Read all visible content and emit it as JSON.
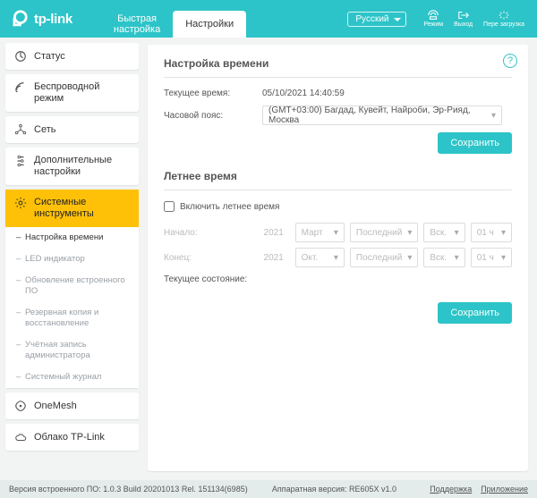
{
  "brand": "tp-link",
  "header": {
    "tabs": {
      "quick": "Быстрая\nнастройка",
      "settings": "Настройки"
    },
    "language": "Русский",
    "icons": {
      "mode": "Режим",
      "logout": "Выход",
      "reload": "Пере загрузка"
    }
  },
  "sidebar": {
    "status": "Статус",
    "wireless": "Беспроводной режим",
    "network": "Сеть",
    "advanced": "Дополнительные настройки",
    "system": "Системные инструменты",
    "system_sub": {
      "time": "Настройка времени",
      "led": "LED индикатор",
      "firmware": "Обновление встроенного ПО",
      "backup": "Резервная копия и восстановление",
      "admin": "Учётная запись администратора",
      "syslog": "Системный журнал"
    },
    "onemesh": "OneMesh",
    "cloud": "Облако TP-Link"
  },
  "content": {
    "time_section": "Настройка времени",
    "current_time_label": "Текущее время:",
    "current_time_value": "05/10/2021 14:40:59",
    "timezone_label": "Часовой пояс:",
    "timezone_value": "(GMT+03:00) Багдад, Кувейт, Найроби, Эр-Рияд, Москва",
    "save": "Сохранить",
    "dst_section": "Летнее время",
    "dst_enable": "Включить летнее время",
    "start_label": "Начало:",
    "end_label": "Конец:",
    "year": "2021",
    "start": {
      "month": "Март",
      "ord": "Последний",
      "day": "Вск.",
      "hour": "01 ч"
    },
    "end": {
      "month": "Окт.",
      "ord": "Последний",
      "day": "Вск.",
      "hour": "01 ч"
    },
    "state_label": "Текущее состояние:"
  },
  "footer": {
    "fw": "Версия встроенного ПО: 1.0.3 Build 20201013 Rel. 151134(6985)",
    "hw": "Аппаратная версия: RE605X v1.0",
    "support": "Поддержка",
    "app": "Приложение"
  }
}
